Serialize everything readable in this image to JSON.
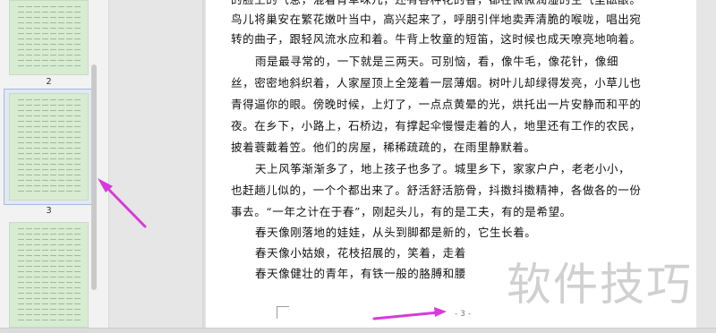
{
  "thumbnails": [
    {
      "label": "2"
    },
    {
      "label": "3"
    },
    {
      "label": ""
    }
  ],
  "document": {
    "lines": [
      "的脸上的气息，混着青草味儿，还有各种花的香，都在微微润湿的空气里酝酿。",
      "鸟儿将巢安在繁花嫩叶当中，高兴起来了，呼朋引伴地卖弄清脆的喉咙，唱出宛",
      "转的曲子，跟轻风流水应和着。牛背上牧童的短笛，这时候也成天嘹亮地响着。",
      "雨是最寻常的，一下就是三两天。可别恼，看，像牛毛，像花针，像细",
      "丝，密密地斜织着，人家屋顶上全笼着一层薄烟。树叶儿却绿得发亮，小草儿也",
      "青得逼你的眼。傍晚时候，上灯了，一点点黄晕的光，烘托出一片安静而和平的",
      "夜。在乡下，小路上，石桥边，有撑起伞慢慢走着的人，地里还有工作的农民，",
      "披着蓑戴着笠。他们的房屋，稀稀疏疏的，在雨里静默着。",
      "天上风筝渐渐多了，地上孩子也多了。城里乡下，家家户户，老老小小，",
      "也赶趟儿似的，一个个都出来了。舒活舒活筋骨，抖擞抖擞精神，各做各的一份",
      "事去。“一年之计在于春”，刚起头儿，有的是工夫，有的是希望。",
      "春天像刚落地的娃娃，从头到脚都是新的，它生长着。",
      "春天像小姑娘，花枝招展的，笑着，走着",
      "春天像健壮的青年，有铁一般的胳膊和腰"
    ],
    "footer_page": "- 3 -"
  },
  "watermark": "软件技巧",
  "colors": {
    "thumbnail_fill": "#d7ecd0",
    "arrow": "#d63bd9",
    "selection_border": "#9fbde6",
    "page": "#ffffff",
    "background": "#e6e6e6"
  }
}
